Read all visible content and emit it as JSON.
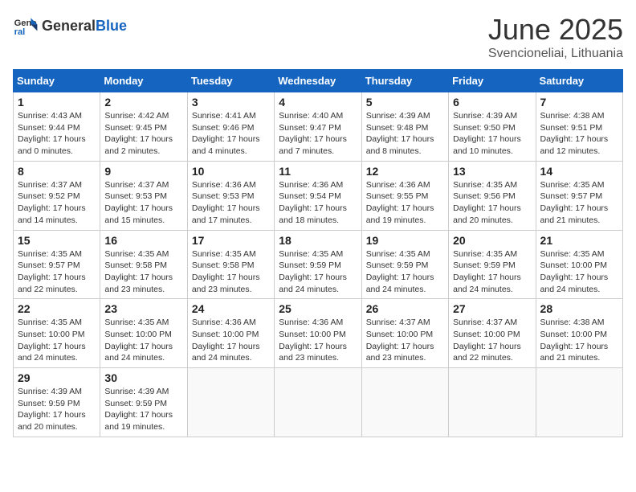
{
  "header": {
    "logo_general": "General",
    "logo_blue": "Blue",
    "month": "June 2025",
    "location": "Svencioneliai, Lithuania"
  },
  "days_of_week": [
    "Sunday",
    "Monday",
    "Tuesday",
    "Wednesday",
    "Thursday",
    "Friday",
    "Saturday"
  ],
  "weeks": [
    [
      {
        "day": "1",
        "sunrise": "4:43 AM",
        "sunset": "9:44 PM",
        "daylight": "17 hours and 0 minutes."
      },
      {
        "day": "2",
        "sunrise": "4:42 AM",
        "sunset": "9:45 PM",
        "daylight": "17 hours and 2 minutes."
      },
      {
        "day": "3",
        "sunrise": "4:41 AM",
        "sunset": "9:46 PM",
        "daylight": "17 hours and 4 minutes."
      },
      {
        "day": "4",
        "sunrise": "4:40 AM",
        "sunset": "9:47 PM",
        "daylight": "17 hours and 7 minutes."
      },
      {
        "day": "5",
        "sunrise": "4:39 AM",
        "sunset": "9:48 PM",
        "daylight": "17 hours and 8 minutes."
      },
      {
        "day": "6",
        "sunrise": "4:39 AM",
        "sunset": "9:50 PM",
        "daylight": "17 hours and 10 minutes."
      },
      {
        "day": "7",
        "sunrise": "4:38 AM",
        "sunset": "9:51 PM",
        "daylight": "17 hours and 12 minutes."
      }
    ],
    [
      {
        "day": "8",
        "sunrise": "4:37 AM",
        "sunset": "9:52 PM",
        "daylight": "17 hours and 14 minutes."
      },
      {
        "day": "9",
        "sunrise": "4:37 AM",
        "sunset": "9:53 PM",
        "daylight": "17 hours and 15 minutes."
      },
      {
        "day": "10",
        "sunrise": "4:36 AM",
        "sunset": "9:53 PM",
        "daylight": "17 hours and 17 minutes."
      },
      {
        "day": "11",
        "sunrise": "4:36 AM",
        "sunset": "9:54 PM",
        "daylight": "17 hours and 18 minutes."
      },
      {
        "day": "12",
        "sunrise": "4:36 AM",
        "sunset": "9:55 PM",
        "daylight": "17 hours and 19 minutes."
      },
      {
        "day": "13",
        "sunrise": "4:35 AM",
        "sunset": "9:56 PM",
        "daylight": "17 hours and 20 minutes."
      },
      {
        "day": "14",
        "sunrise": "4:35 AM",
        "sunset": "9:57 PM",
        "daylight": "17 hours and 21 minutes."
      }
    ],
    [
      {
        "day": "15",
        "sunrise": "4:35 AM",
        "sunset": "9:57 PM",
        "daylight": "17 hours and 22 minutes."
      },
      {
        "day": "16",
        "sunrise": "4:35 AM",
        "sunset": "9:58 PM",
        "daylight": "17 hours and 23 minutes."
      },
      {
        "day": "17",
        "sunrise": "4:35 AM",
        "sunset": "9:58 PM",
        "daylight": "17 hours and 23 minutes."
      },
      {
        "day": "18",
        "sunrise": "4:35 AM",
        "sunset": "9:59 PM",
        "daylight": "17 hours and 24 minutes."
      },
      {
        "day": "19",
        "sunrise": "4:35 AM",
        "sunset": "9:59 PM",
        "daylight": "17 hours and 24 minutes."
      },
      {
        "day": "20",
        "sunrise": "4:35 AM",
        "sunset": "9:59 PM",
        "daylight": "17 hours and 24 minutes."
      },
      {
        "day": "21",
        "sunrise": "4:35 AM",
        "sunset": "10:00 PM",
        "daylight": "17 hours and 24 minutes."
      }
    ],
    [
      {
        "day": "22",
        "sunrise": "4:35 AM",
        "sunset": "10:00 PM",
        "daylight": "17 hours and 24 minutes."
      },
      {
        "day": "23",
        "sunrise": "4:35 AM",
        "sunset": "10:00 PM",
        "daylight": "17 hours and 24 minutes."
      },
      {
        "day": "24",
        "sunrise": "4:36 AM",
        "sunset": "10:00 PM",
        "daylight": "17 hours and 24 minutes."
      },
      {
        "day": "25",
        "sunrise": "4:36 AM",
        "sunset": "10:00 PM",
        "daylight": "17 hours and 23 minutes."
      },
      {
        "day": "26",
        "sunrise": "4:37 AM",
        "sunset": "10:00 PM",
        "daylight": "17 hours and 23 minutes."
      },
      {
        "day": "27",
        "sunrise": "4:37 AM",
        "sunset": "10:00 PM",
        "daylight": "17 hours and 22 minutes."
      },
      {
        "day": "28",
        "sunrise": "4:38 AM",
        "sunset": "10:00 PM",
        "daylight": "17 hours and 21 minutes."
      }
    ],
    [
      {
        "day": "29",
        "sunrise": "4:39 AM",
        "sunset": "9:59 PM",
        "daylight": "17 hours and 20 minutes."
      },
      {
        "day": "30",
        "sunrise": "4:39 AM",
        "sunset": "9:59 PM",
        "daylight": "17 hours and 19 minutes."
      },
      null,
      null,
      null,
      null,
      null
    ]
  ]
}
